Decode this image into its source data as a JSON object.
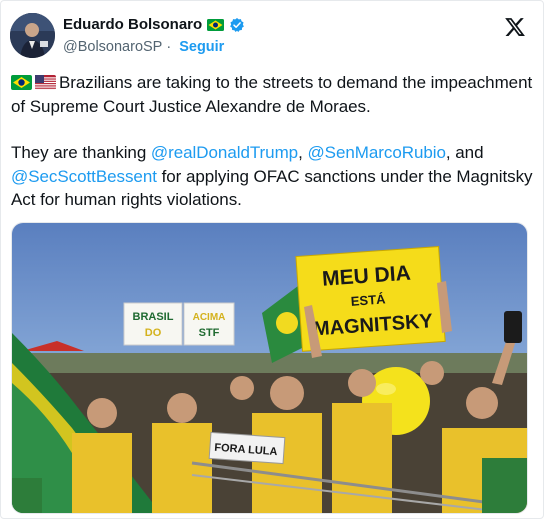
{
  "author": {
    "name": "Eduardo Bolsonaro",
    "handle": "@BolsonaroSP",
    "separator": "·",
    "follow_label": "Seguir"
  },
  "icons": {
    "brand": "x-logo-icon",
    "verified": "verified-badge-icon",
    "flags": [
      "brazil-flag-icon",
      "usa-flag-icon"
    ]
  },
  "tweet": {
    "line1_text": "Brazilians are taking to the streets to demand the impeachment of Supreme Court Justice Alexandre de Moraes.",
    "line2_before": "They are thanking ",
    "mention1": "@realDonaldTrump",
    "sep1": ", ",
    "mention2": "@SenMarcoRubio",
    "sep2": ",",
    "line2_and": " and ",
    "mention3": "@SecScottBessent",
    "line2_after": " for applying OFAC sanctions under the Magnitsky Act for human rights violations."
  },
  "media": {
    "sign_main_1": "MEU DIA",
    "sign_main_2": "ESTÁ",
    "sign_main_3": "MAGNITSKY",
    "sign_left_1": "BRASIL",
    "sign_left_2": "DO",
    "sign_right_1": "ACIMA",
    "sign_right_2": "STF",
    "sign_small": "FORA LULA"
  },
  "colors": {
    "mention_blue": "#1d9bf0",
    "brazil_green": "#009c3b",
    "brazil_yellow": "#ffdf00"
  }
}
